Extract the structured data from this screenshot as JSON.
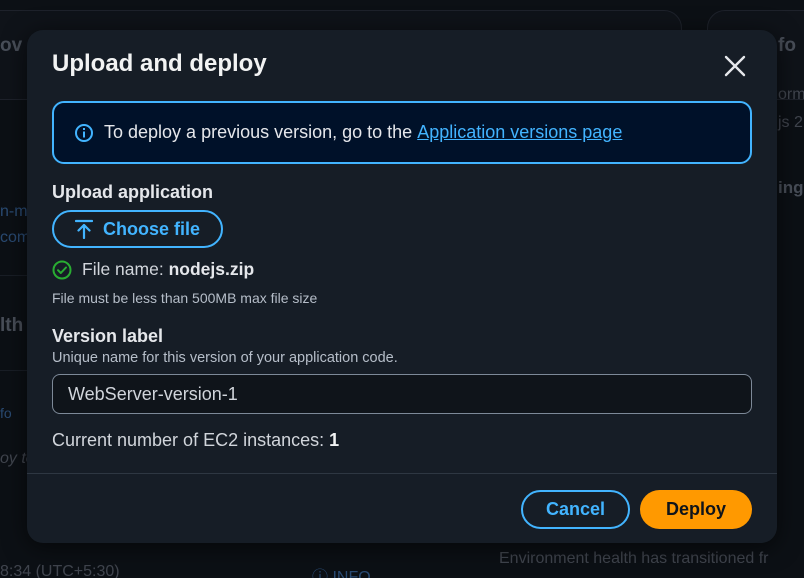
{
  "background": {
    "left_heading_fragment": "ov",
    "right_heading_fragment": "fo",
    "right_text_1": "orm",
    "right_text_2": "js 2",
    "right_text_3": "ing",
    "left_link_1": "n-m",
    "left_link_2": "com",
    "left_heading_2": "lth",
    "left_link_3": "fo",
    "left_text_1": "oy te",
    "bottom_time": "8:34 (UTC+5:30)",
    "bottom_info": "INFO",
    "bottom_message": "Environment health has transitioned fr"
  },
  "modal": {
    "title": "Upload and deploy",
    "alert": {
      "text": "To deploy a previous version, go to the",
      "link": "Application versions page"
    },
    "upload": {
      "label": "Upload application",
      "button": "Choose file",
      "file_prefix": "File name:",
      "file_name": "nodejs.zip",
      "constraint": "File must be less than 500MB max file size"
    },
    "version": {
      "label": "Version label",
      "description": "Unique name for this version of your application code.",
      "value": "WebServer-version-1"
    },
    "instances": {
      "label": "Current number of EC2 instances:",
      "count": "1"
    },
    "footer": {
      "cancel": "Cancel",
      "deploy": "Deploy"
    }
  },
  "colors": {
    "accent": "#42b4ff",
    "primary_button": "#ff9900",
    "success": "#29ad32",
    "modal_bg": "#161d26",
    "alert_bg": "#001129"
  }
}
